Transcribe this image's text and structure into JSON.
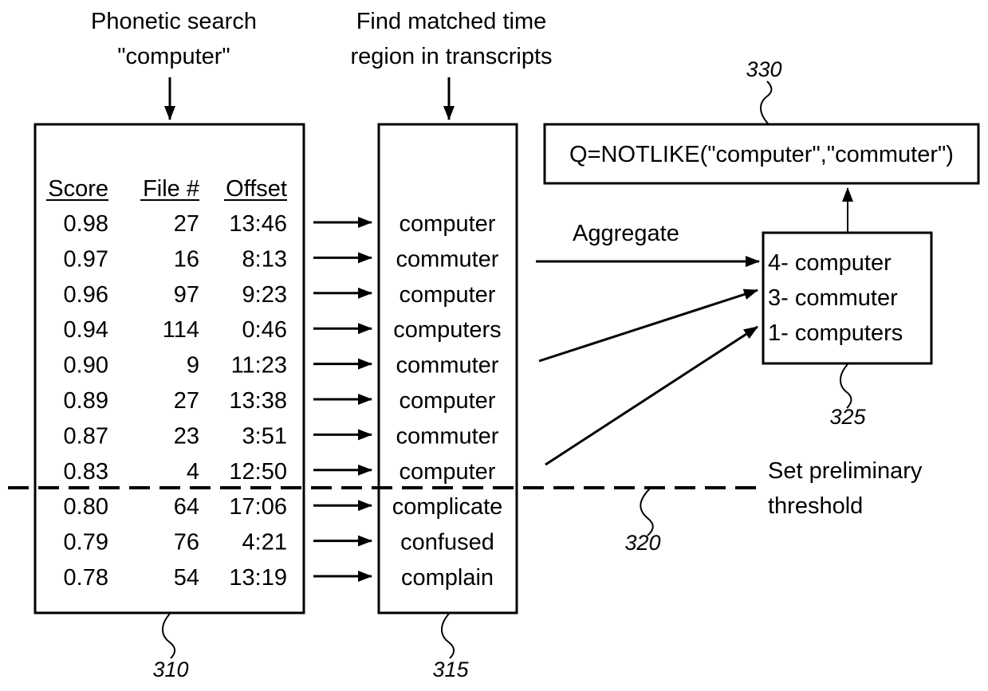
{
  "labels": {
    "phonetic_search_line1": "Phonetic search",
    "phonetic_search_line2": "\"computer\"",
    "find_matched_line1": "Find matched time",
    "find_matched_line2": "region in transcripts",
    "aggregate": "Aggregate",
    "threshold_line1": "Set preliminary",
    "threshold_line2": "threshold"
  },
  "refs": {
    "results_box": "310",
    "transcript_box": "315",
    "threshold_line": "320",
    "aggregate_box": "325",
    "query_box": "330"
  },
  "results_table": {
    "headers": [
      "Score",
      "File #",
      "Offset"
    ],
    "rows": [
      {
        "score": "0.98",
        "file": "27",
        "offset": "13:46",
        "word": "computer"
      },
      {
        "score": "0.97",
        "file": "16",
        "offset": "8:13",
        "word": "commuter"
      },
      {
        "score": "0.96",
        "file": "97",
        "offset": "9:23",
        "word": "computer"
      },
      {
        "score": "0.94",
        "file": "114",
        "offset": "0:46",
        "word": "computers"
      },
      {
        "score": "0.90",
        "file": "9",
        "offset": "11:23",
        "word": "commuter"
      },
      {
        "score": "0.89",
        "file": "27",
        "offset": "13:38",
        "word": "computer"
      },
      {
        "score": "0.87",
        "file": "23",
        "offset": "3:51",
        "word": "commuter"
      },
      {
        "score": "0.83",
        "file": "4",
        "offset": "12:50",
        "word": "computer"
      },
      {
        "score": "0.80",
        "file": "64",
        "offset": "17:06",
        "word": "complicate"
      },
      {
        "score": "0.79",
        "file": "76",
        "offset": "4:21",
        "word": "confused"
      },
      {
        "score": "0.78",
        "file": "54",
        "offset": "13:19",
        "word": "complain"
      }
    ],
    "threshold_after_row": 8
  },
  "aggregate_box": {
    "items": [
      "4- computer",
      "3- commuter",
      "1- computers"
    ]
  },
  "query_box": {
    "text": "Q=NOTLIKE(\"computer\",\"commuter\")"
  }
}
